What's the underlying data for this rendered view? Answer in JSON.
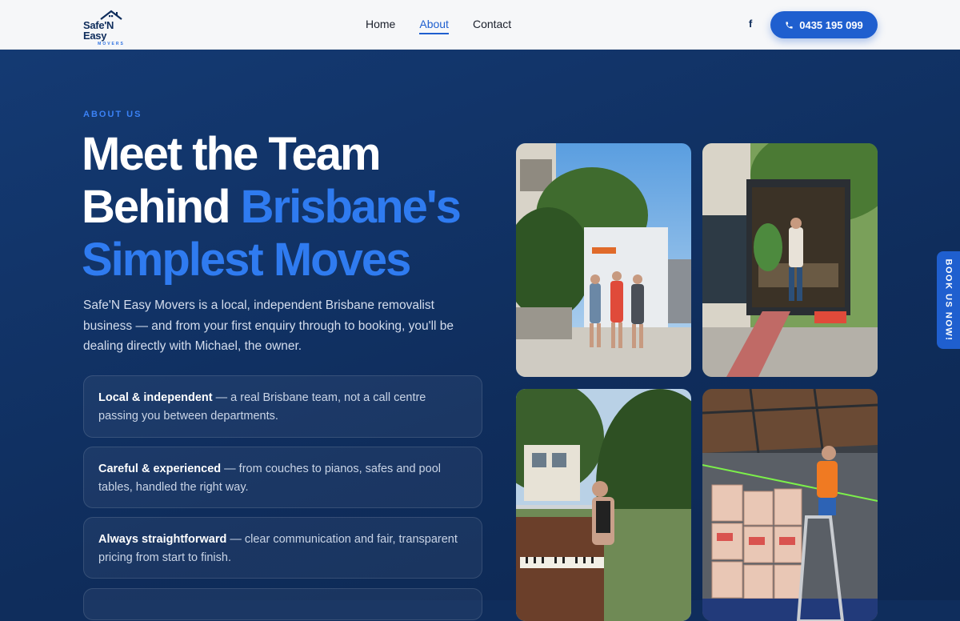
{
  "brand": {
    "name": "Safe'N Easy",
    "tagline": "MOVERS"
  },
  "nav": {
    "items": [
      {
        "label": "Home"
      },
      {
        "label": "About"
      },
      {
        "label": "Contact"
      }
    ],
    "active": "About"
  },
  "header": {
    "facebook_icon": "f",
    "phone": "0435 195 099"
  },
  "hero": {
    "eyebrow": "ABOUT US",
    "title_line1": "Meet the Team",
    "title_line2_plain": "Behind ",
    "title_line2_highlight": "Brisbane's",
    "title_line3_highlight": "Simplest Moves",
    "lead": "Safe'N Easy Movers is a local, independent Brisbane removalist business — and from your first enquiry through to booking, you'll be dealing directly with Michael, the owner."
  },
  "features": [
    {
      "bold": "Local & independent",
      "text": " — a real Brisbane team, not a call centre passing you between departments."
    },
    {
      "bold": "Careful & experienced",
      "text": " — from couches to pianos, safes and pool tables, handled the right way."
    },
    {
      "bold": "Always straightforward",
      "text": " — clear communication and fair, transparent pricing from start to finish."
    }
  ],
  "photos": [
    {
      "icon": "team-truck-photo"
    },
    {
      "icon": "truck-ramp-photo"
    },
    {
      "icon": "piano-mover-photo"
    },
    {
      "icon": "truck-loading-photo"
    }
  ],
  "book_tab": {
    "label": "BOOK US NOW!"
  },
  "colors": {
    "accent": "#1f5fcf",
    "navy": "#0f2d5c",
    "highlight": "#2f7bf0"
  }
}
